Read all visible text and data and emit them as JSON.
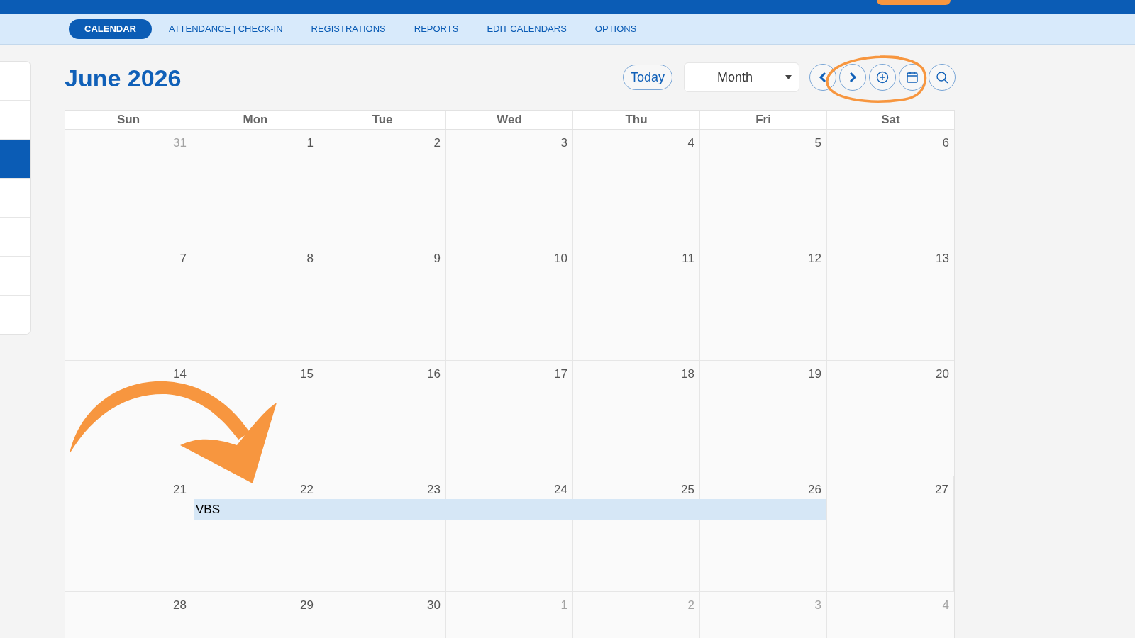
{
  "tabs": [
    {
      "label": "CALENDAR",
      "selected": true
    },
    {
      "label": "ATTENDANCE | CHECK-IN",
      "selected": false
    },
    {
      "label": "REGISTRATIONS",
      "selected": false
    },
    {
      "label": "REPORTS",
      "selected": false
    },
    {
      "label": "EDIT CALENDARS",
      "selected": false
    },
    {
      "label": "OPTIONS",
      "selected": false
    }
  ],
  "sidebar": {
    "items": [
      {
        "selected": false
      },
      {
        "selected": false
      },
      {
        "selected": true
      },
      {
        "selected": false
      },
      {
        "selected": false
      },
      {
        "selected": false
      },
      {
        "selected": false
      }
    ]
  },
  "title": "June 2026",
  "today_button": "Today",
  "view_select": {
    "value": "Month"
  },
  "weekdays": [
    "Sun",
    "Mon",
    "Tue",
    "Wed",
    "Thu",
    "Fri",
    "Sat"
  ],
  "weeks": [
    {
      "days": [
        {
          "day": "31",
          "muted": true
        },
        {
          "day": "1",
          "muted": false
        },
        {
          "day": "2",
          "muted": false
        },
        {
          "day": "3",
          "muted": false
        },
        {
          "day": "4",
          "muted": false
        },
        {
          "day": "5",
          "muted": false
        },
        {
          "day": "6",
          "muted": false
        }
      ]
    },
    {
      "days": [
        {
          "day": "7",
          "muted": false
        },
        {
          "day": "8",
          "muted": false
        },
        {
          "day": "9",
          "muted": false
        },
        {
          "day": "10",
          "muted": false
        },
        {
          "day": "11",
          "muted": false
        },
        {
          "day": "12",
          "muted": false
        },
        {
          "day": "13",
          "muted": false
        }
      ]
    },
    {
      "days": [
        {
          "day": "14",
          "muted": false
        },
        {
          "day": "15",
          "muted": false
        },
        {
          "day": "16",
          "muted": false
        },
        {
          "day": "17",
          "muted": false
        },
        {
          "day": "18",
          "muted": false
        },
        {
          "day": "19",
          "muted": false
        },
        {
          "day": "20",
          "muted": false
        }
      ]
    },
    {
      "event": {
        "title": "VBS"
      },
      "days": [
        {
          "day": "21",
          "muted": false,
          "in_event": false
        },
        {
          "day": "22",
          "muted": false,
          "in_event": true
        },
        {
          "day": "23",
          "muted": false,
          "in_event": true
        },
        {
          "day": "24",
          "muted": false,
          "in_event": true
        },
        {
          "day": "25",
          "muted": false,
          "in_event": true
        },
        {
          "day": "26",
          "muted": false,
          "in_event": true
        },
        {
          "day": "27",
          "muted": false,
          "in_event": false
        }
      ]
    },
    {
      "days": [
        {
          "day": "28",
          "muted": false
        },
        {
          "day": "29",
          "muted": false
        },
        {
          "day": "30",
          "muted": false
        },
        {
          "day": "1",
          "muted": true
        },
        {
          "day": "2",
          "muted": true
        },
        {
          "day": "3",
          "muted": true
        },
        {
          "day": "4",
          "muted": true
        }
      ]
    }
  ]
}
